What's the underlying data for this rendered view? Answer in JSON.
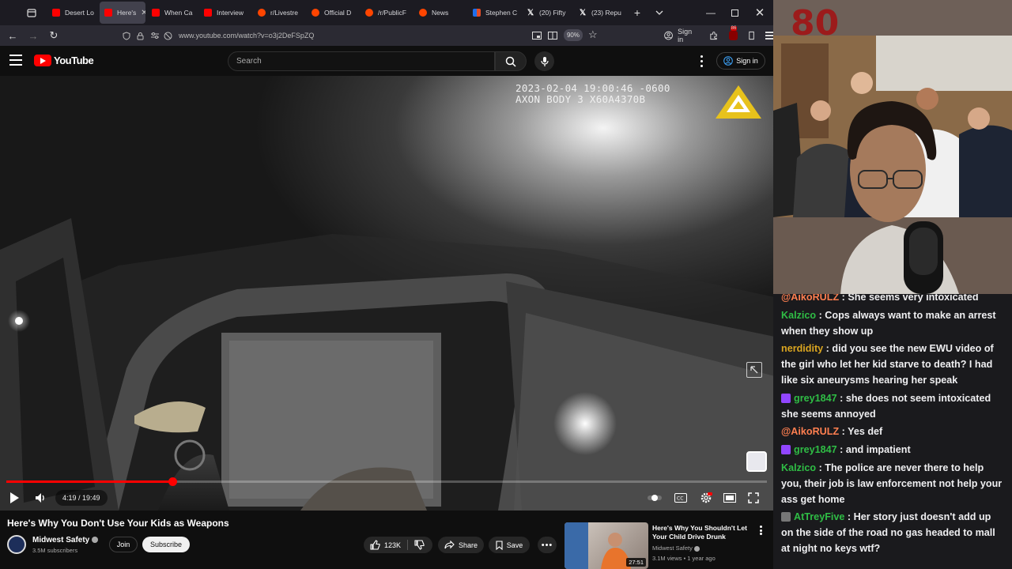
{
  "browser": {
    "tabs": [
      {
        "label": "Desert Lo",
        "icon": "youtube-icon",
        "active": false
      },
      {
        "label": "Here's",
        "icon": "youtube-icon",
        "active": true
      },
      {
        "label": "When Ca",
        "icon": "youtube-icon",
        "active": false
      },
      {
        "label": "Interview",
        "icon": "youtube-icon",
        "active": false
      },
      {
        "label": "r/Livestre",
        "icon": "reddit-icon",
        "active": false
      },
      {
        "label": "Official D",
        "icon": "reddit-icon",
        "active": false
      },
      {
        "label": "/r/PublicF",
        "icon": "reddit-icon",
        "active": false
      },
      {
        "label": "News",
        "icon": "reddit-icon",
        "active": false
      },
      {
        "label": "Stephen C",
        "icon": "msn-icon",
        "active": false
      },
      {
        "label": "(20) Fifty",
        "icon": "x-icon",
        "active": false
      },
      {
        "label": "(23) Repu",
        "icon": "x-icon",
        "active": false
      }
    ],
    "url": "www.youtube.com/watch?v=o3j2DeFSpZQ",
    "zoom": "90%",
    "sign_in": "Sign in",
    "extension_badge": "86"
  },
  "youtube": {
    "logo_text": "YouTube",
    "search_placeholder": "Search",
    "sign_in": "Sign in"
  },
  "video": {
    "overlay_timestamp": "2023-02-04 19:00:46 -0600",
    "overlay_device": "AXON BODY 3 X60A4370B",
    "current_time": "4:19",
    "duration": "19:49",
    "time_display": "4:19 / 19:49",
    "progress_fraction": 0.218,
    "buffer_knob_fraction": 0.27,
    "title": "Here's Why You Don't Use Your Kids as Weapons",
    "channel": "Midwest Safety",
    "subscribers": "3.5M subscribers",
    "join_label": "Join",
    "subscribe_label": "Subscribe",
    "likes": "123K",
    "share_label": "Share",
    "save_label": "Save"
  },
  "recommendation": {
    "title": "Here's Why You Shouldn't Let Your Child Drive Drunk",
    "channel": "Midwest Safety",
    "meta": "3.1M views • 1 year ago",
    "duration": "27:51"
  },
  "chat": {
    "messages": [
      {
        "user": "@AikoRULZ",
        "color": "#ff7f50",
        "badge": "",
        "text": "She seems very intoxicated"
      },
      {
        "user": "Kalzico",
        "color": "#2fbd45",
        "badge": "",
        "text": "Cops always want to make an arrest when they show up"
      },
      {
        "user": "nerdidity",
        "color": "#daa520",
        "badge": "",
        "text": "did you see the new EWU video of the girl who let her kid starve to death? I had like six aneurysms hearing her speak"
      },
      {
        "user": "grey1847",
        "color": "#2fbd45",
        "badge": "#9146ff",
        "text": "she does not seem intoxicated she seems annoyed"
      },
      {
        "user": "@AikoRULZ",
        "color": "#ff7f50",
        "badge": "",
        "text": "Yes def"
      },
      {
        "user": "grey1847",
        "color": "#2fbd45",
        "badge": "#9146ff",
        "text": "and impatient"
      },
      {
        "user": "Kalzico",
        "color": "#2fbd45",
        "badge": "",
        "text": "The police are never there to help you, their job is law enforcement not help your ass get home"
      },
      {
        "user": "AtTreyFive",
        "color": "#2fbd45",
        "badge": "#777777",
        "text": "Her story just doesn't add up on the side of the road no gas headed to mall at night no keys wtf?"
      }
    ]
  },
  "colors": {
    "accent": "#ff0000",
    "link": "#3ea6ff",
    "chat_bg": "#1a1a1d"
  }
}
